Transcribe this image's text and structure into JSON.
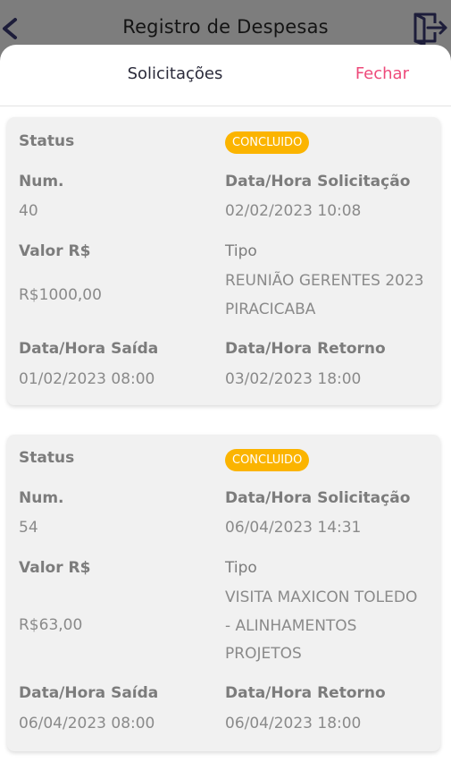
{
  "header": {
    "title": "Registro de Despesas"
  },
  "sheet": {
    "title": "Solicitações",
    "close_label": "Fechar"
  },
  "labels": {
    "status": "Status",
    "num": "Num.",
    "data_solicitacao": "Data/Hora Solicitação",
    "valor": "Valor R$",
    "tipo": "Tipo",
    "data_saida": "Data/Hora Saída",
    "data_retorno": "Data/Hora Retorno"
  },
  "colors": {
    "badge": "#fbb400",
    "close": "#ee4a7a"
  },
  "requests": [
    {
      "status": "CONCLUIDO",
      "num": "40",
      "data_solicitacao": "02/02/2023 10:08",
      "valor": "R$1000,00",
      "tipo": "REUNIÃO GERENTES 2023 PIRACICABA",
      "data_saida": "01/02/2023 08:00",
      "data_retorno": "03/02/2023 18:00"
    },
    {
      "status": "CONCLUIDO",
      "num": "54",
      "data_solicitacao": "06/04/2023 14:31",
      "valor": "R$63,00",
      "tipo": "VISITA MAXICON TOLEDO - ALINHAMENTOS PROJETOS",
      "data_saida": "06/04/2023 08:00",
      "data_retorno": "06/04/2023 18:00"
    }
  ]
}
